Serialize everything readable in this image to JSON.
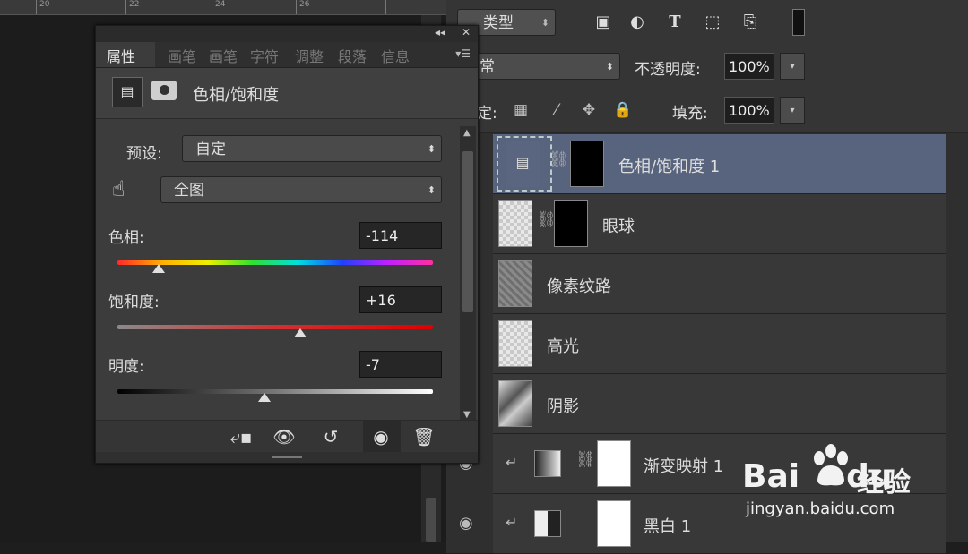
{
  "ruler": {
    "numbers": [
      "20",
      "22",
      "24",
      "26"
    ]
  },
  "layers_panel": {
    "kind_filter": "类型",
    "blend_mode": "常",
    "opacity_label": "不透明度:",
    "opacity_value": "100%",
    "lock_label": "定:",
    "fill_label": "填充:",
    "fill_value": "100%",
    "layers": [
      {
        "name": "色相/饱和度 1",
        "selected": true
      },
      {
        "name": "眼球"
      },
      {
        "name": "像素纹路"
      },
      {
        "name": "高光"
      },
      {
        "name": "阴影"
      },
      {
        "name": "渐变映射 1"
      },
      {
        "name": "黑白 1"
      }
    ]
  },
  "properties_panel": {
    "tabs": [
      "属性",
      "画笔",
      "画笔",
      "字符",
      "调整",
      "段落",
      "信息"
    ],
    "title": "色相/饱和度",
    "preset_label": "预设:",
    "preset_value": "自定",
    "channel_value": "全图",
    "hue_label": "色相:",
    "hue_value": "-114",
    "hue_fraction": 0.13,
    "saturation_label": "饱和度:",
    "saturation_value": "+16",
    "saturation_fraction": 0.58,
    "lightness_label": "明度:",
    "lightness_value": "-7",
    "lightness_fraction": 0.465
  },
  "watermark": {
    "brand": "Bai",
    "brand2": "du",
    "jingyan": "经验",
    "url": "jingyan.baidu.com"
  }
}
